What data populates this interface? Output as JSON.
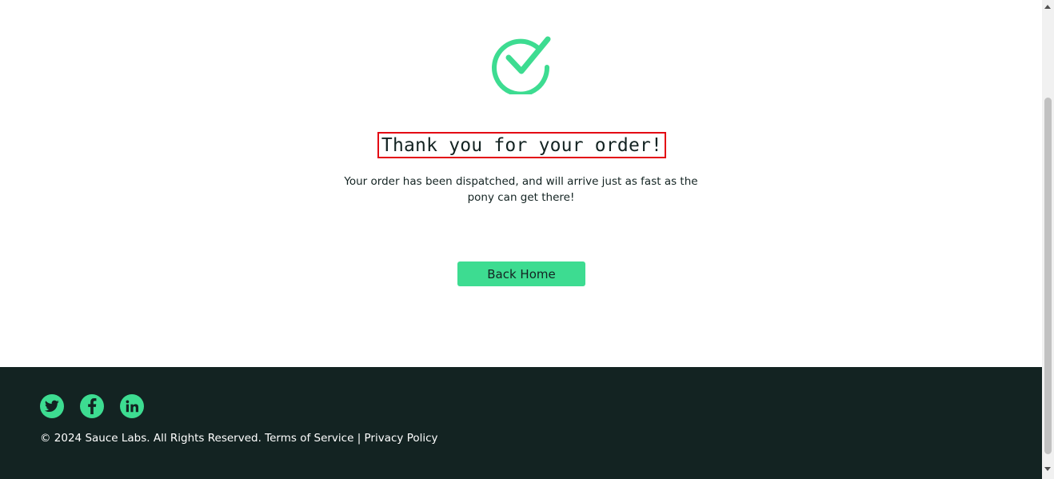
{
  "checkout_complete": {
    "heading": "Thank you for your order!",
    "message": "Your order has been dispatched, and will arrive just as fast as the pony can get there!",
    "back_button": "Back Home",
    "icon": "checkmark-circle-icon",
    "accent_color": "#3ddc91",
    "highlight_color": "#e30613"
  },
  "footer": {
    "social": [
      {
        "name": "twitter",
        "icon": "twitter-icon"
      },
      {
        "name": "facebook",
        "icon": "facebook-icon"
      },
      {
        "name": "linkedin",
        "icon": "linkedin-icon"
      }
    ],
    "copyright": "© 2024 Sauce Labs. All Rights Reserved. Terms of Service | Privacy Policy",
    "background_color": "#132322"
  }
}
